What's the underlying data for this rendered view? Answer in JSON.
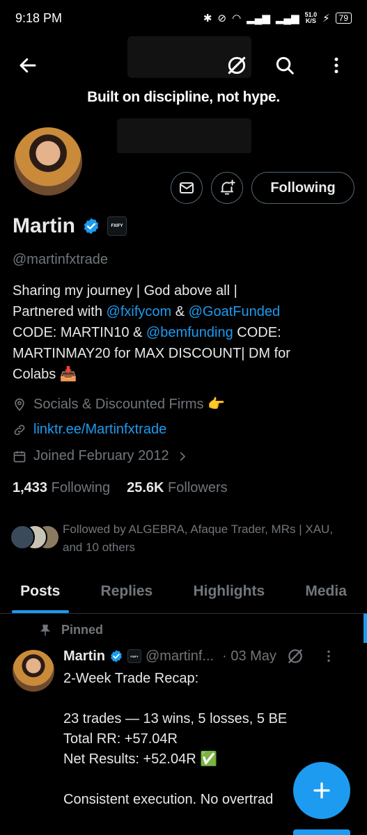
{
  "status_bar": {
    "time": "9:18 PM",
    "net_speed_value": "51.0",
    "net_speed_unit": "K/S",
    "battery": "79"
  },
  "banner": {
    "tagline": "Built on discipline, not hype."
  },
  "profile": {
    "name": "Martin",
    "handle": "@martinfxtrade",
    "affiliate_badge": "FXIFY",
    "follow_button": "Following",
    "bio": {
      "line1": "Sharing my journey | God above all |",
      "line2_pre": "Partnered with ",
      "link1": "@fxifycom",
      "line2_mid": " & ",
      "link2": "@GoatFunded",
      "line3_pre": "CODE: MARTIN10 & ",
      "link3": "@bemfunding",
      "line3_post": " CODE:",
      "line4": "MARTINMAY20 for MAX DISCOUNT| DM for",
      "line5": "Colabs 📥"
    },
    "location": "Socials & Discounted Firms 👉",
    "website": "linktr.ee/Martinfxtrade",
    "joined": "Joined February 2012",
    "following_count": "1,433",
    "following_label": "Following",
    "followers_count": "25.6K",
    "followers_label": "Followers",
    "followed_by": "Followed by ALGEBRA, Afaque Trader, MRs | XAU, and 10 others"
  },
  "tabs": [
    "Posts",
    "Replies",
    "Highlights",
    "Media"
  ],
  "pinned_post": {
    "pinned_label": "Pinned",
    "author": "Martin",
    "handle": "@martinf...",
    "date": "· 03 May",
    "body": "2-Week Trade Recap:\n\n23 trades — 13 wins, 5 losses, 5 BE\nTotal RR: +57.04R\nNet Results: +52.04R ✅\n\nConsistent execution. No overtrad"
  },
  "colors": {
    "accent": "#1d9bf0",
    "muted": "#71767b",
    "text": "#e7e9ea",
    "background": "#000000"
  }
}
